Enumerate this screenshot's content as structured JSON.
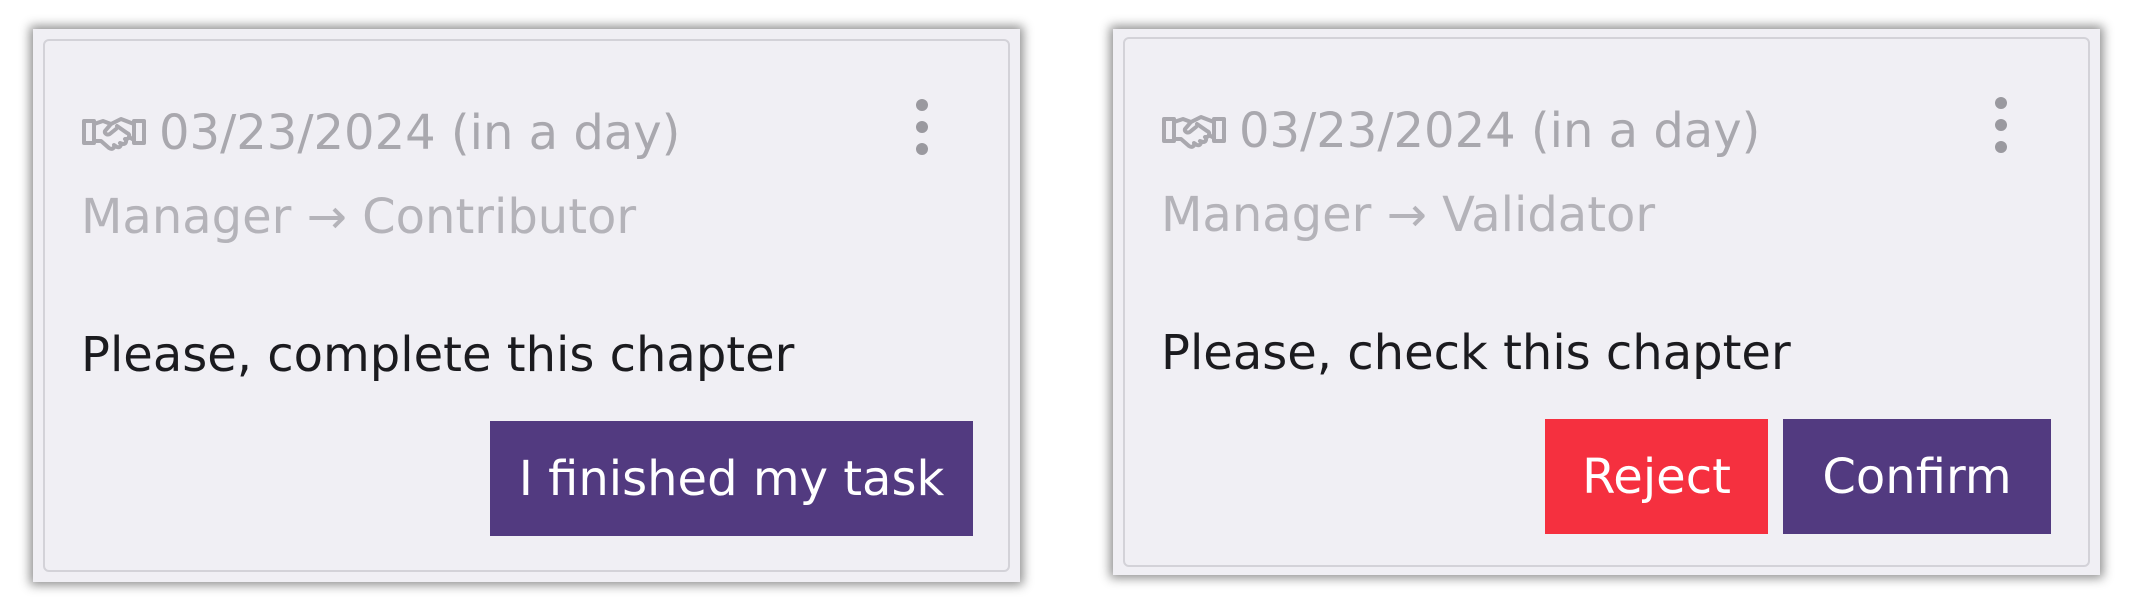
{
  "cards": [
    {
      "date_text": "03/23/2024 (in a day)",
      "roles_text": "Manager → Contributor",
      "message": "Please, complete this chapter",
      "buttons": [
        {
          "label": "I finished my task",
          "color": "#523a80"
        }
      ]
    },
    {
      "date_text": "03/23/2024 (in a day)",
      "roles_text": "Manager → Validator",
      "message": "Please, check this chapter",
      "buttons": [
        {
          "label": "Reject",
          "color": "#f5303f"
        },
        {
          "label": "Confirm",
          "color": "#523a80"
        }
      ]
    }
  ],
  "icons": {
    "date": "handshake-icon",
    "menu": "more-vertical-icon"
  }
}
